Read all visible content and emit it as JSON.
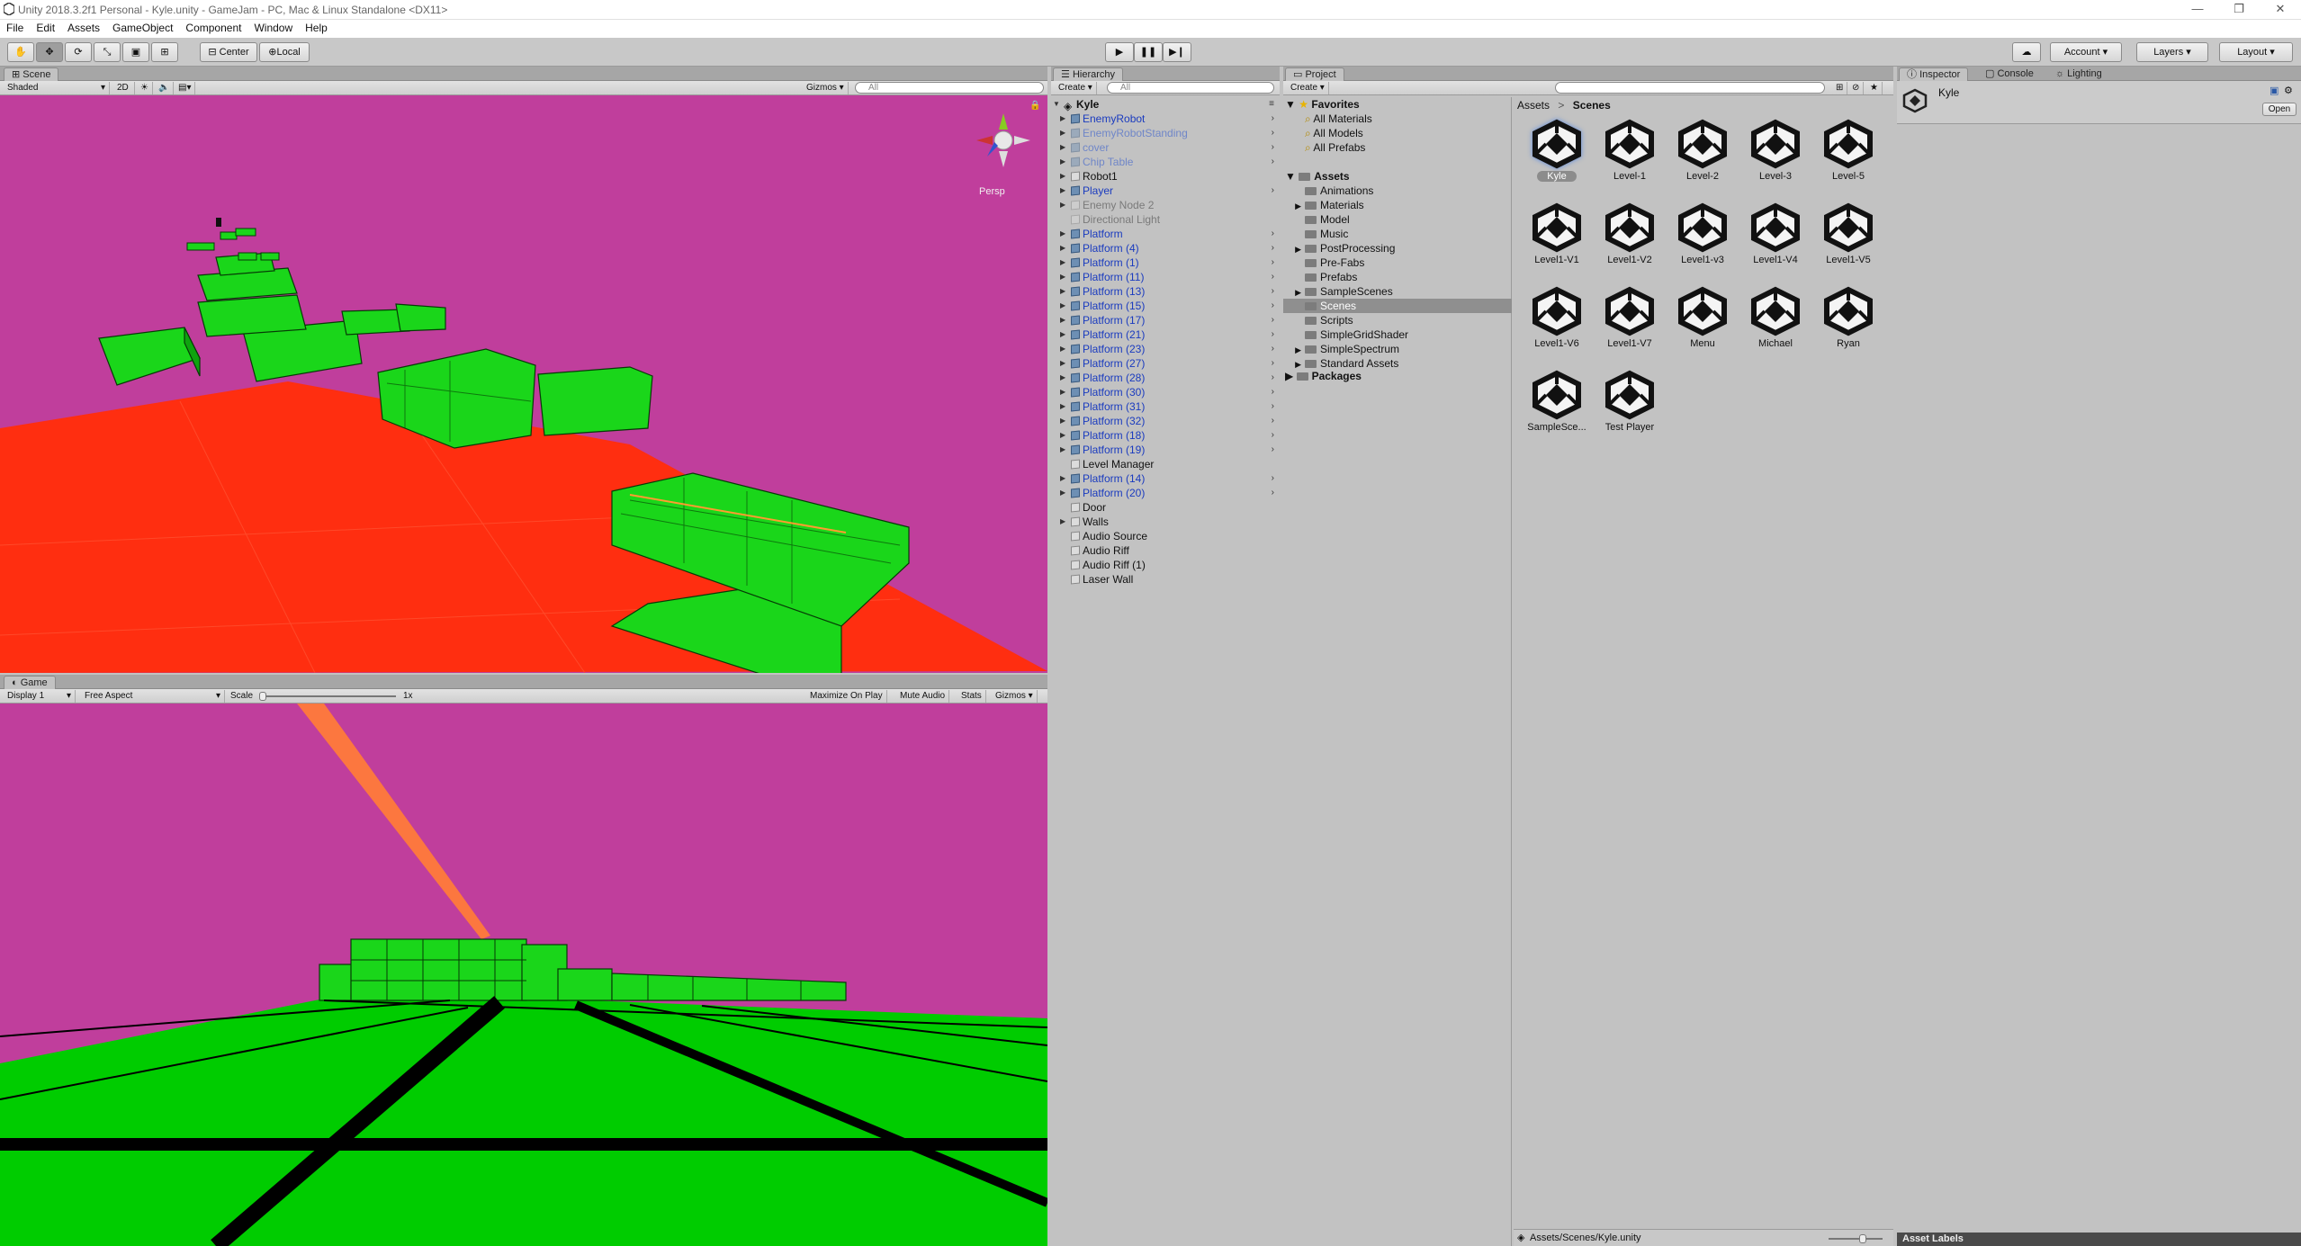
{
  "window": {
    "title": "Unity 2018.3.2f1 Personal - Kyle.unity - GameJam - PC, Mac & Linux Standalone <DX11>"
  },
  "menu": [
    "File",
    "Edit",
    "Assets",
    "GameObject",
    "Component",
    "Window",
    "Help"
  ],
  "toolbar": {
    "pivot": "Center",
    "space": "Local",
    "account": "Account",
    "layers": "Layers",
    "layout": "Layout"
  },
  "scene": {
    "tab": "Scene",
    "shading": "Shaded",
    "mode2d": "2D",
    "gizmos": "Gizmos",
    "search_placeholder": "All",
    "persp": "Persp",
    "colors": {
      "sky": "#c03e9c",
      "ground": "#ff2e10",
      "block": "#1ad61a"
    }
  },
  "game": {
    "tab": "Game",
    "display": "Display 1",
    "aspect": "Free Aspect",
    "scale_label": "Scale",
    "scale_value": "1x",
    "maximize": "Maximize On Play",
    "mute": "Mute Audio",
    "stats": "Stats",
    "gizmos": "Gizmos",
    "colors": {
      "sky": "#c03e9c",
      "ground": "#00cc00",
      "beam": "#ff7a3a"
    }
  },
  "hierarchy": {
    "tab": "Hierarchy",
    "create": "Create",
    "search_placeholder": "All",
    "scene_name": "Kyle",
    "items": [
      {
        "label": "EnemyRobot",
        "style": "blue",
        "expand": true,
        "chev": true
      },
      {
        "label": "EnemyRobotStanding",
        "style": "fadeblue",
        "expand": true,
        "chev": true
      },
      {
        "label": "cover",
        "style": "fadeblue",
        "expand": true,
        "chev": true
      },
      {
        "label": "Chip Table",
        "style": "fadeblue",
        "expand": true,
        "chev": true
      },
      {
        "label": "Robot1",
        "style": "normal",
        "expand": true,
        "chev": false
      },
      {
        "label": "Player",
        "style": "blue",
        "expand": true,
        "chev": true
      },
      {
        "label": "Enemy Node 2",
        "style": "fade",
        "expand": true,
        "chev": false
      },
      {
        "label": "Directional Light",
        "style": "fade",
        "expand": false,
        "chev": false
      },
      {
        "label": "Platform",
        "style": "blue",
        "expand": true,
        "chev": true
      },
      {
        "label": "Platform (4)",
        "style": "blue",
        "expand": true,
        "chev": true
      },
      {
        "label": "Platform (1)",
        "style": "blue",
        "expand": true,
        "chev": true
      },
      {
        "label": "Platform (11)",
        "style": "blue",
        "expand": true,
        "chev": true
      },
      {
        "label": "Platform (13)",
        "style": "blue",
        "expand": true,
        "chev": true
      },
      {
        "label": "Platform (15)",
        "style": "blue",
        "expand": true,
        "chev": true
      },
      {
        "label": "Platform (17)",
        "style": "blue",
        "expand": true,
        "chev": true
      },
      {
        "label": "Platform (21)",
        "style": "blue",
        "expand": true,
        "chev": true
      },
      {
        "label": "Platform (23)",
        "style": "blue",
        "expand": true,
        "chev": true
      },
      {
        "label": "Platform (27)",
        "style": "blue",
        "expand": true,
        "chev": true
      },
      {
        "label": "Platform (28)",
        "style": "blue",
        "expand": true,
        "chev": true
      },
      {
        "label": "Platform (30)",
        "style": "blue",
        "expand": true,
        "chev": true
      },
      {
        "label": "Platform (31)",
        "style": "blue",
        "expand": true,
        "chev": true
      },
      {
        "label": "Platform (32)",
        "style": "blue",
        "expand": true,
        "chev": true
      },
      {
        "label": "Platform (18)",
        "style": "blue",
        "expand": true,
        "chev": true
      },
      {
        "label": "Platform (19)",
        "style": "blue",
        "expand": true,
        "chev": true
      },
      {
        "label": "Level Manager",
        "style": "normal",
        "expand": false,
        "chev": false
      },
      {
        "label": "Platform (14)",
        "style": "blue",
        "expand": true,
        "chev": true
      },
      {
        "label": "Platform (20)",
        "style": "blue",
        "expand": true,
        "chev": true
      },
      {
        "label": "Door",
        "style": "normal",
        "expand": false,
        "chev": false
      },
      {
        "label": "Walls",
        "style": "normal",
        "expand": true,
        "chev": false
      },
      {
        "label": "Audio Source",
        "style": "normal",
        "expand": false,
        "chev": false
      },
      {
        "label": "Audio Riff",
        "style": "normal",
        "expand": false,
        "chev": false
      },
      {
        "label": "Audio Riff (1)",
        "style": "normal",
        "expand": false,
        "chev": false
      },
      {
        "label": "Laser Wall",
        "style": "normal",
        "expand": false,
        "chev": false
      }
    ]
  },
  "project": {
    "tab": "Project",
    "create": "Create",
    "favorites_label": "Favorites",
    "favorites": [
      "All Materials",
      "All Models",
      "All Prefabs"
    ],
    "assets_label": "Assets",
    "folders": [
      {
        "label": "Animations",
        "expand": false
      },
      {
        "label": "Materials",
        "expand": true
      },
      {
        "label": "Model",
        "expand": false
      },
      {
        "label": "Music",
        "expand": false
      },
      {
        "label": "PostProcessing",
        "expand": true
      },
      {
        "label": "Pre-Fabs",
        "expand": false
      },
      {
        "label": "Prefabs",
        "expand": false
      },
      {
        "label": "SampleScenes",
        "expand": true
      },
      {
        "label": "Scenes",
        "expand": false,
        "selected": true
      },
      {
        "label": "Scripts",
        "expand": false
      },
      {
        "label": "SimpleGridShader",
        "expand": false
      },
      {
        "label": "SimpleSpectrum",
        "expand": true
      },
      {
        "label": "Standard Assets",
        "expand": true
      }
    ],
    "packages_label": "Packages",
    "breadcrumb": {
      "root": "Assets",
      "sep": ">",
      "current": "Scenes"
    },
    "scenes": [
      "Kyle",
      "Level-1",
      "Level-2",
      "Level-3",
      "Level-5",
      "Level1-V1",
      "Level1-V2",
      "Level1-v3",
      "Level1-V4",
      "Level1-V5",
      "Level1-V6",
      "Level1-V7",
      "Menu",
      "Michael",
      "Ryan",
      "SampleSce...",
      "Test Player"
    ],
    "footer_path": "Assets/Scenes/Kyle.unity"
  },
  "inspector": {
    "tab": "Inspector",
    "console_tab": "Console",
    "lighting_tab": "Lighting",
    "object_name": "Kyle",
    "open_button": "Open",
    "asset_labels": "Asset Labels"
  }
}
